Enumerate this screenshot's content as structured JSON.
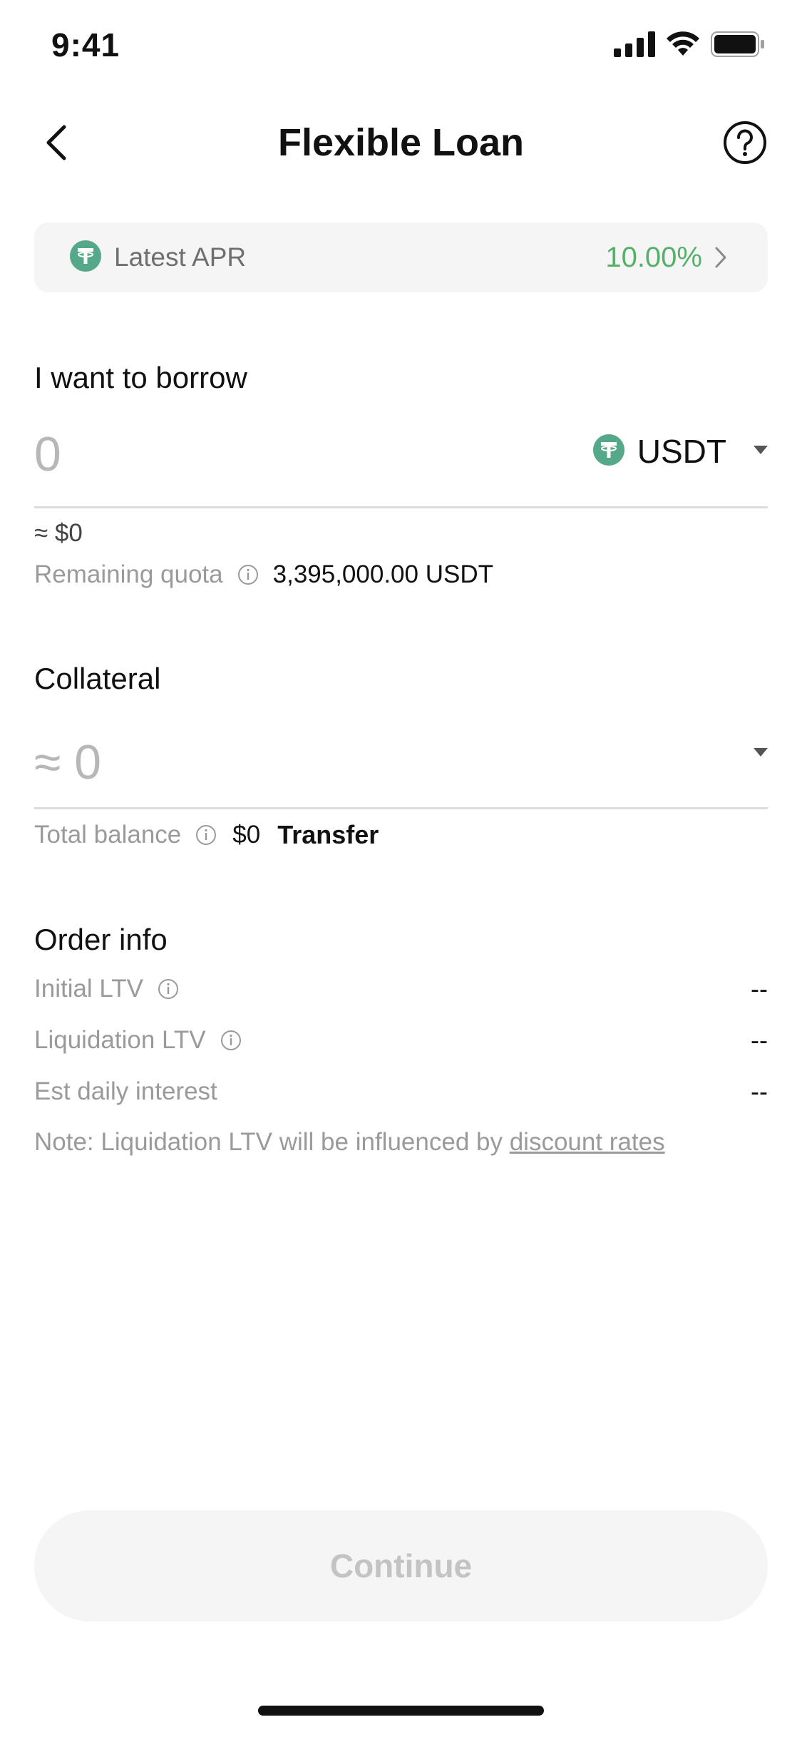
{
  "status_bar": {
    "time": "9:41",
    "icons": [
      "signal-icon",
      "wifi-icon",
      "battery-icon"
    ]
  },
  "header": {
    "title": "Flexible Loan",
    "back_icon": "chevron-left-icon",
    "help_icon": "question-circle-icon"
  },
  "apr_banner": {
    "label": "Latest APR",
    "value": "10.00%",
    "coin_icon": "tether-icon"
  },
  "borrow": {
    "title": "I want to borrow",
    "amount_placeholder": "0",
    "coin": "USDT",
    "usd_value": "≈ $0",
    "quota_label": "Remaining quota",
    "quota_value": "3,395,000.00 USDT"
  },
  "collateral": {
    "title": "Collateral",
    "value": "≈ 0",
    "balance_label": "Total balance",
    "balance_value": "$0",
    "transfer_label": "Transfer"
  },
  "order_info": {
    "title": "Order info",
    "rows": [
      {
        "label": "Initial LTV",
        "value": "--"
      },
      {
        "label": "Liquidation LTV",
        "value": "--"
      },
      {
        "label": "Est daily interest",
        "value": "--"
      }
    ],
    "note_prefix": "Note: Liquidation LTV will be influenced by ",
    "note_link": "discount rates"
  },
  "continue_label": "Continue",
  "colors": {
    "accent_green": "#55b06a",
    "tether_green": "#55a889",
    "muted_text": "#9a9a9a",
    "card_bg": "#f5f5f5"
  }
}
